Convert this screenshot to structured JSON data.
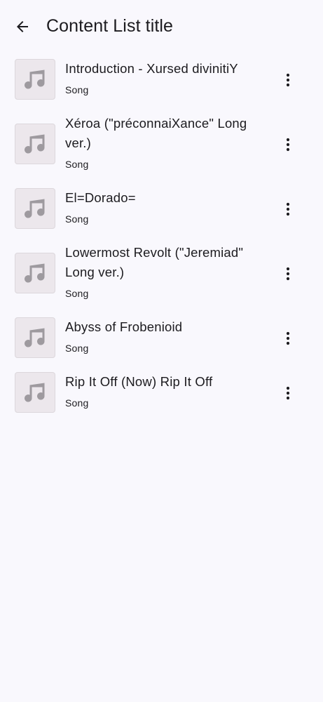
{
  "header": {
    "title": "Content List title",
    "back_icon": "arrow-back-icon"
  },
  "items": [
    {
      "title": "Introduction - Xursed divinitiY",
      "subtitle": "Song",
      "thumb_icon": "music-note-icon",
      "menu_icon": "more-vert-icon"
    },
    {
      "title": "Xéroa (\"préconnaiXance\" Long ver.)",
      "subtitle": "Song",
      "thumb_icon": "music-note-icon",
      "menu_icon": "more-vert-icon"
    },
    {
      "title": "El=Dorado=",
      "subtitle": "Song",
      "thumb_icon": "music-note-icon",
      "menu_icon": "more-vert-icon"
    },
    {
      "title": "Lowermost Revolt (\"Jeremiad\" Long ver.)",
      "subtitle": "Song",
      "thumb_icon": "music-note-icon",
      "menu_icon": "more-vert-icon"
    },
    {
      "title": "Abyss of Frobenioid",
      "subtitle": "Song",
      "thumb_icon": "music-note-icon",
      "menu_icon": "more-vert-icon"
    },
    {
      "title": "Rip It Off (Now) Rip It Off",
      "subtitle": "Song",
      "thumb_icon": "music-note-icon",
      "menu_icon": "more-vert-icon"
    }
  ],
  "colors": {
    "background": "#f9f8fd",
    "text": "#1c1b1f",
    "thumb_bg": "#ece7ec",
    "icon_gray": "#9e9a9f"
  }
}
